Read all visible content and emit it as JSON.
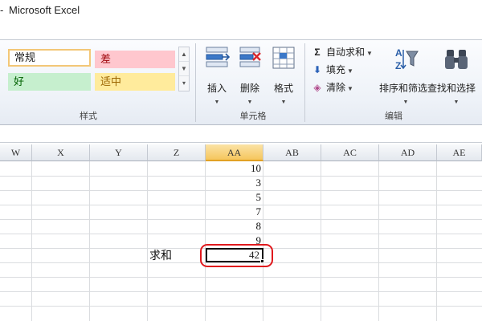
{
  "window": {
    "title": "Microsoft Excel",
    "left_mark": "-"
  },
  "ribbon": {
    "styles": {
      "normal": "常规",
      "bad": "差",
      "good": "好",
      "neutral": "适中",
      "group_label": "样式"
    },
    "cells": {
      "insert": "插入",
      "delete": "删除",
      "format": "格式",
      "group_label": "单元格"
    },
    "editing": {
      "autosum": "自动求和",
      "fill": "填充",
      "clear": "清除",
      "sort_filter": "排序和筛选",
      "find_select": "查找和选择",
      "group_label": "编辑"
    }
  },
  "grid": {
    "columns": [
      "W",
      "X",
      "Y",
      "Z",
      "AA",
      "AB",
      "AC",
      "AD",
      "AE"
    ],
    "active_column": "AA",
    "values": [
      "10",
      "3",
      "5",
      "7",
      "8",
      "9"
    ],
    "sum_label": "求和",
    "sum_value": "42"
  },
  "colors": {
    "highlight": "#e0191d",
    "active_header": "#f5c65d"
  }
}
